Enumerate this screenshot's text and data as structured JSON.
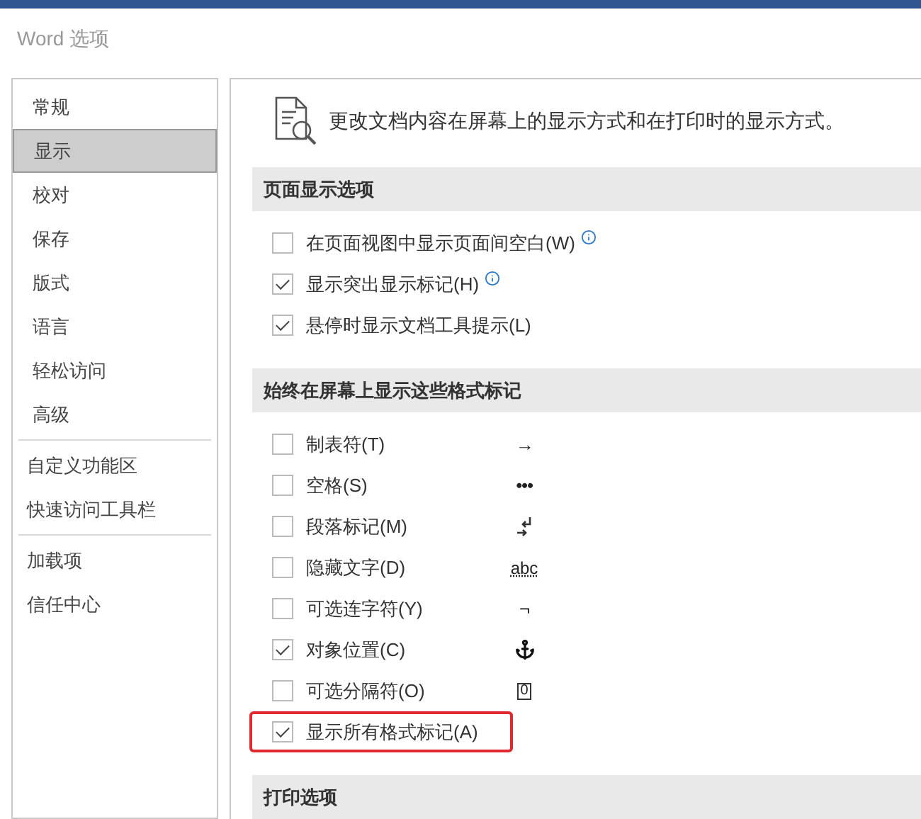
{
  "window": {
    "title": "Word 选项"
  },
  "sidebar": {
    "groups": [
      [
        {
          "label": "常规",
          "selected": false
        },
        {
          "label": "显示",
          "selected": true
        },
        {
          "label": "校对",
          "selected": false
        },
        {
          "label": "保存",
          "selected": false
        },
        {
          "label": "版式",
          "selected": false
        },
        {
          "label": "语言",
          "selected": false
        },
        {
          "label": "轻松访问",
          "selected": false
        },
        {
          "label": "高级",
          "selected": false
        }
      ],
      [
        {
          "label": "自定义功能区",
          "selected": false
        },
        {
          "label": "快速访问工具栏",
          "selected": false
        }
      ],
      [
        {
          "label": "加载项",
          "selected": false
        },
        {
          "label": "信任中心",
          "selected": false
        }
      ]
    ]
  },
  "header": {
    "text": "更改文档内容在屏幕上的显示方式和在打印时的显示方式。"
  },
  "sections": [
    {
      "title": "页面显示选项",
      "options": [
        {
          "label": "在页面视图中显示页面间空白(W)",
          "checked": false,
          "info": true,
          "highlighted": false
        },
        {
          "label": "显示突出显示标记(H)",
          "checked": true,
          "info": true,
          "highlighted": false
        },
        {
          "label": "悬停时显示文档工具提示(L)",
          "checked": true,
          "info": false,
          "highlighted": false
        }
      ]
    },
    {
      "title": "始终在屏幕上显示这些格式标记",
      "options": [
        {
          "label": "制表符(T)",
          "checked": false,
          "info": false,
          "highlighted": false,
          "mark": {
            "kind": "text",
            "symbol": "→"
          }
        },
        {
          "label": "空格(S)",
          "checked": false,
          "info": false,
          "highlighted": false,
          "mark": {
            "kind": "text",
            "symbol": "•••"
          }
        },
        {
          "label": "段落标记(M)",
          "checked": false,
          "info": false,
          "highlighted": false,
          "mark": {
            "kind": "paragraph"
          }
        },
        {
          "label": "隐藏文字(D)",
          "checked": false,
          "info": false,
          "highlighted": false,
          "mark": {
            "kind": "dotted",
            "symbol": "abc"
          }
        },
        {
          "label": "可选连字符(Y)",
          "checked": false,
          "info": false,
          "highlighted": false,
          "mark": {
            "kind": "text",
            "symbol": "¬"
          }
        },
        {
          "label": "对象位置(C)",
          "checked": true,
          "info": false,
          "highlighted": false,
          "mark": {
            "kind": "anchor"
          }
        },
        {
          "label": "可选分隔符(O)",
          "checked": false,
          "info": false,
          "highlighted": false,
          "mark": {
            "kind": "boxed",
            "symbol": "0"
          }
        },
        {
          "label": "显示所有格式标记(A)",
          "checked": true,
          "info": false,
          "highlighted": true
        }
      ]
    },
    {
      "title": "打印选项"
    }
  ]
}
